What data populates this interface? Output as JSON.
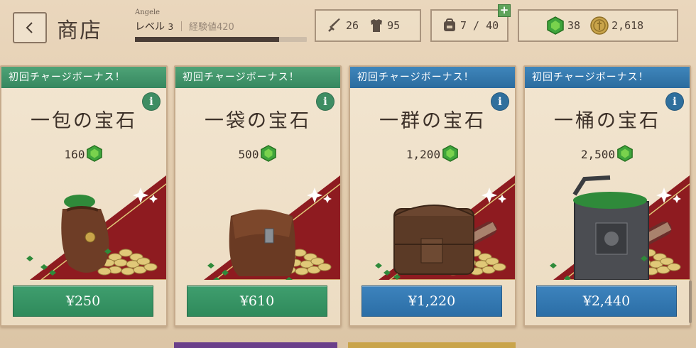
{
  "header": {
    "title": "商店",
    "player_name": "Angele",
    "level_label": "レベル",
    "level_value": "3",
    "xp_label": "経験値",
    "xp_value": "420",
    "xp_progress": 0.84
  },
  "stats": {
    "attack": "26",
    "defense": "95",
    "inventory": "7 / 40",
    "gems": "38",
    "gold": "2,618"
  },
  "cards": [
    {
      "ribbon": "初回チャージボーナス！",
      "theme": "green",
      "name": "一包の宝石",
      "gems": "160",
      "price": "¥250",
      "art": "pouch-icon"
    },
    {
      "ribbon": "初回チャージボーナス！",
      "theme": "green",
      "name": "一袋の宝石",
      "gems": "500",
      "price": "¥610",
      "art": "bag-icon"
    },
    {
      "ribbon": "初回チャージボーナス！",
      "theme": "blue",
      "name": "一群の宝石",
      "gems": "1,200",
      "price": "¥1,220",
      "art": "chest-icon"
    },
    {
      "ribbon": "初回チャージボーナス！",
      "theme": "blue",
      "name": "一桶の宝石",
      "gems": "2,500",
      "price": "¥2,440",
      "art": "barrel-icon"
    }
  ],
  "info_glyph": "i",
  "colors": {
    "green_accent": "#36875f",
    "blue_accent": "#2b6b9e",
    "gem_green": "#3fa43c",
    "carpet_red": "#9b1e22"
  }
}
